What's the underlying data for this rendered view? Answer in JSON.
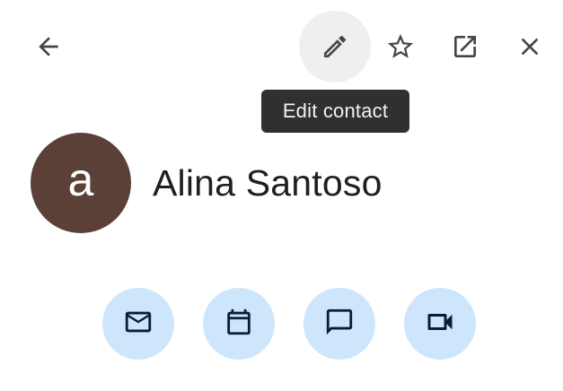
{
  "toolbar": {
    "back_icon": "arrow-back-icon",
    "edit_icon": "pencil-icon",
    "star_icon": "star-outline-icon",
    "open_icon": "open-in-new-icon",
    "close_icon": "close-icon",
    "hover_background": "#efefef"
  },
  "tooltip": {
    "text": "Edit contact",
    "background": "#303030"
  },
  "contact": {
    "avatar_letter": "a",
    "avatar_color": "#5b4038",
    "name": "Alina Santoso"
  },
  "actions": [
    {
      "icon": "mail-icon"
    },
    {
      "icon": "calendar-icon"
    },
    {
      "icon": "chat-icon"
    },
    {
      "icon": "videocam-icon"
    }
  ],
  "colors": {
    "action_background": "#cde6fb",
    "action_icon": "#0b1d33",
    "toolbar_icon": "#444746",
    "text": "#1f1f1f"
  }
}
